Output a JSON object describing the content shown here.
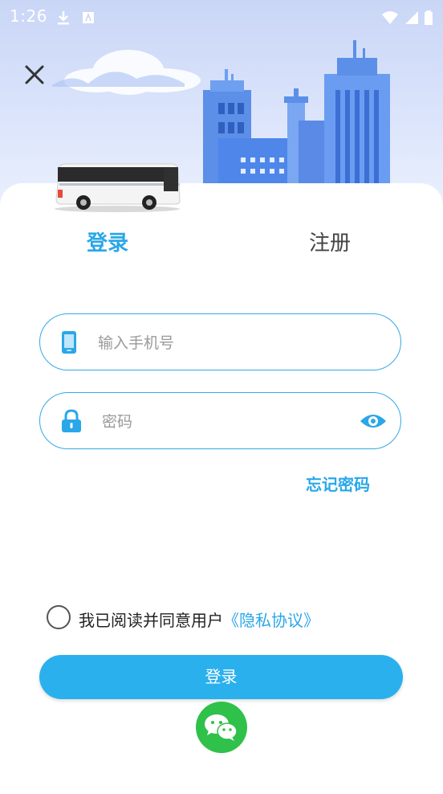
{
  "status_bar": {
    "time": "1:26"
  },
  "tabs": {
    "login": "登录",
    "register": "注册"
  },
  "form": {
    "phone_placeholder": "输入手机号",
    "password_placeholder": "密码",
    "forgot_password": "忘记密码"
  },
  "agreement": {
    "text": "我已阅读并同意用户",
    "link": "《隐私协议》"
  },
  "login_button": "登录",
  "icons": {
    "close": "close-icon",
    "phone": "phone-icon",
    "lock": "lock-icon",
    "eye": "eye-icon",
    "wechat": "wechat-icon"
  },
  "colors": {
    "accent": "#2aa7e8",
    "button": "#2bb0ee",
    "wechat": "#2fc14a"
  }
}
